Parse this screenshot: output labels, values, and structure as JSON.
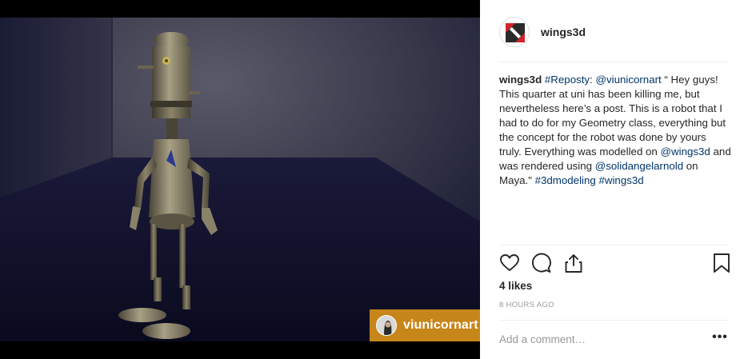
{
  "post": {
    "author": "wings3d",
    "caption": {
      "username": "wings3d",
      "tag_reposty": "#Reposty",
      "sep": ": ",
      "mention_viunicornart": "@viunicornart",
      "text1": " “ Hey guys! This quarter at uni has been killing me, but nevertheless here’s a post. This is a robot that I had to do for my Geometry class, everything but the concept for the robot was done by yours truly. Everything was modelled on ",
      "mention_wings3d": "@wings3d",
      "text2": " and was rendered using ",
      "mention_solidangle": "@solidangelarnold",
      "text3": " on Maya.\" ",
      "tag_3dmodeling": "#3dmodeling",
      "space": " ",
      "tag_wings3d": "#wings3d"
    },
    "likes": "4 likes",
    "timestamp": "8 HOURS AGO",
    "comment_placeholder": "Add a comment…",
    "more_label": "•••"
  },
  "media": {
    "repost_credit": "viunicornart"
  },
  "icons": {
    "like": "heart-icon",
    "comment": "comment-icon",
    "share": "share-icon",
    "save": "bookmark-icon",
    "more": "more-options-icon"
  },
  "colors": {
    "link": "#003569",
    "repost_badge": "#c7861a",
    "meta_gray": "#999999"
  }
}
